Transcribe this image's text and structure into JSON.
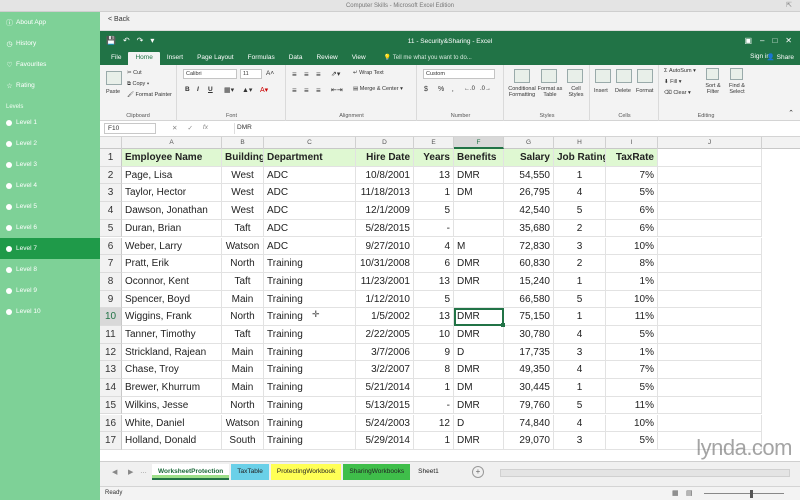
{
  "window": {
    "title": "Computer Skills - Microsoft Excel Edition"
  },
  "sidebar": {
    "items": [
      {
        "label": "About App",
        "icon": "info-icon"
      },
      {
        "label": "History",
        "icon": "clock-icon"
      },
      {
        "label": "Favourites",
        "icon": "heart-icon"
      },
      {
        "label": "Rating",
        "icon": "star-icon"
      }
    ],
    "levels_heading": "Levels",
    "levels": [
      {
        "label": "Level 1",
        "active": false
      },
      {
        "label": "Level 2",
        "active": false
      },
      {
        "label": "Level 3",
        "active": false
      },
      {
        "label": "Level 4",
        "active": false
      },
      {
        "label": "Level 5",
        "active": false
      },
      {
        "label": "Level 6",
        "active": false
      },
      {
        "label": "Level 7",
        "active": true
      },
      {
        "label": "Level 8",
        "active": false
      },
      {
        "label": "Level 9",
        "active": false
      },
      {
        "label": "Level 10",
        "active": false
      }
    ]
  },
  "back_label": "< Back",
  "excel": {
    "title": "11 - Security&Sharing - Excel",
    "tabs": [
      "File",
      "Home",
      "Insert",
      "Page Layout",
      "Formulas",
      "Data",
      "Review",
      "View"
    ],
    "active_tab": "Home",
    "tell_me": "Tell me what you want to do...",
    "sign_in": "Sign in",
    "share": "Share",
    "ribbon": {
      "clipboard": {
        "label": "Clipboard",
        "paste": "Paste",
        "cut": "Cut",
        "copy": "Copy",
        "format_painter": "Format Painter"
      },
      "font": {
        "label": "Font",
        "name": "Calibri",
        "size": "11",
        "bold": "B",
        "italic": "I",
        "underline": "U"
      },
      "alignment": {
        "label": "Alignment",
        "wrap": "Wrap Text",
        "merge": "Merge & Center"
      },
      "number": {
        "label": "Number",
        "format": "Custom",
        "currency": "$",
        "percent": "%"
      },
      "styles": {
        "label": "Styles",
        "conditional": "Conditional Formatting",
        "table": "Format as Table",
        "cell_styles": "Cell Styles"
      },
      "cells": {
        "label": "Cells",
        "insert": "Insert",
        "delete": "Delete",
        "format": "Format"
      },
      "editing": {
        "label": "Editing",
        "autosum": "AutoSum",
        "fill": "Fill",
        "clear": "Clear",
        "sort": "Sort & Filter",
        "find": "Find & Select"
      }
    },
    "name_box": "F10",
    "formula": "DMR",
    "columns": [
      "A",
      "B",
      "C",
      "D",
      "E",
      "F",
      "G",
      "H",
      "I",
      "J"
    ],
    "selected_column": "F",
    "selected_row": 10,
    "rows": [
      [
        "Employee Name",
        "Building",
        "Department",
        "Hire Date",
        "Years",
        "Benefits",
        "Salary",
        "Job Rating",
        "TaxRate"
      ],
      [
        "Page, Lisa",
        "West",
        "ADC",
        "10/8/2001",
        "13",
        "DMR",
        "54,550",
        "1",
        "7%"
      ],
      [
        "Taylor, Hector",
        "West",
        "ADC",
        "11/18/2013",
        "1",
        "DM",
        "26,795",
        "4",
        "5%"
      ],
      [
        "Dawson, Jonathan",
        "West",
        "ADC",
        "12/1/2009",
        "5",
        "",
        "42,540",
        "5",
        "6%"
      ],
      [
        "Duran, Brian",
        "Taft",
        "ADC",
        "5/28/2015",
        "-",
        "",
        "35,680",
        "2",
        "6%"
      ],
      [
        "Weber, Larry",
        "Watson",
        "ADC",
        "9/27/2010",
        "4",
        "M",
        "72,830",
        "3",
        "10%"
      ],
      [
        "Pratt, Erik",
        "North",
        "Training",
        "10/31/2008",
        "6",
        "DMR",
        "60,830",
        "2",
        "8%"
      ],
      [
        "Oconnor, Kent",
        "Taft",
        "Training",
        "11/23/2001",
        "13",
        "DMR",
        "15,240",
        "1",
        "1%"
      ],
      [
        "Spencer, Boyd",
        "Main",
        "Training",
        "1/12/2010",
        "5",
        "",
        "66,580",
        "5",
        "10%"
      ],
      [
        "Wiggins, Frank",
        "North",
        "Training",
        "1/5/2002",
        "13",
        "DMR",
        "75,150",
        "1",
        "11%"
      ],
      [
        "Tanner, Timothy",
        "Taft",
        "Training",
        "2/22/2005",
        "10",
        "DMR",
        "30,780",
        "4",
        "5%"
      ],
      [
        "Strickland, Rajean",
        "Main",
        "Training",
        "3/7/2006",
        "9",
        "D",
        "17,735",
        "3",
        "1%"
      ],
      [
        "Chase, Troy",
        "Main",
        "Training",
        "3/2/2007",
        "8",
        "DMR",
        "49,350",
        "4",
        "7%"
      ],
      [
        "Brewer, Khurrum",
        "Main",
        "Training",
        "5/21/2014",
        "1",
        "DM",
        "30,445",
        "1",
        "5%"
      ],
      [
        "Wilkins, Jesse",
        "North",
        "Training",
        "5/13/2015",
        "-",
        "DMR",
        "79,760",
        "5",
        "11%"
      ],
      [
        "White, Daniel",
        "Watson",
        "Training",
        "5/24/2003",
        "12",
        "D",
        "74,840",
        "4",
        "10%"
      ],
      [
        "Holland, Donald",
        "South",
        "Training",
        "5/29/2014",
        "1",
        "DMR",
        "29,070",
        "3",
        "5%"
      ]
    ],
    "sheets": [
      {
        "name": "WorksheetProtection",
        "color": "#9ee08a",
        "active": true
      },
      {
        "name": "TaxTable",
        "color": "#6ad0e8",
        "active": false
      },
      {
        "name": "ProtectingWorkbook",
        "color": "#ffff55",
        "active": false
      },
      {
        "name": "SharingWorkbooks",
        "color": "#3fbe4a",
        "active": false
      },
      {
        "name": "Sheet1",
        "color": "",
        "active": false
      }
    ],
    "status": "Ready",
    "watermark": "lynda.com"
  }
}
